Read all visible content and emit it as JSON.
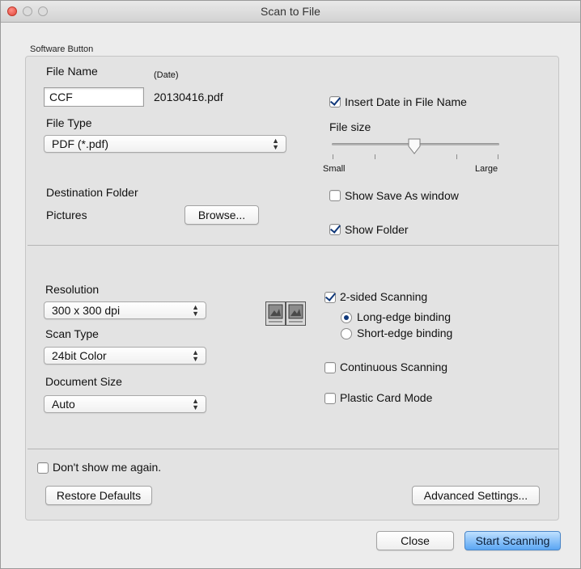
{
  "window": {
    "title": "Scan to File"
  },
  "software_button": {
    "section_label": "Software Button",
    "file_name_label": "File Name",
    "file_name_value": "CCF",
    "date_label": "(Date)",
    "date_value": "20130416.pdf",
    "insert_date": {
      "label": "Insert Date in File Name",
      "checked": true
    },
    "file_type_label": "File Type",
    "file_type_value": "PDF (*.pdf)",
    "file_size": {
      "label": "File size",
      "min_label": "Small",
      "max_label": "Large",
      "level": 0.5
    },
    "destination_label": "Destination Folder",
    "destination_value": "Pictures",
    "browse_label": "Browse...",
    "show_save_as": {
      "label": "Show Save As window",
      "checked": false
    },
    "show_folder": {
      "label": "Show Folder",
      "checked": true
    }
  },
  "scan_settings": {
    "resolution_label": "Resolution",
    "resolution_value": "300 x 300 dpi",
    "scan_type_label": "Scan Type",
    "scan_type_value": "24bit Color",
    "document_size_label": "Document Size",
    "document_size_value": "Auto",
    "two_sided": {
      "label": "2-sided Scanning",
      "checked": true
    },
    "long_edge": {
      "label": "Long-edge binding",
      "selected": true
    },
    "short_edge": {
      "label": "Short-edge binding",
      "selected": false
    },
    "continuous": {
      "label": "Continuous Scanning",
      "checked": false
    },
    "plastic_card": {
      "label": "Plastic Card Mode",
      "checked": false
    },
    "binding_icon": "two-sided-binding-icon"
  },
  "footer": {
    "dont_show": {
      "label": "Don't show me again.",
      "checked": false
    },
    "restore_label": "Restore Defaults",
    "advanced_label": "Advanced Settings...",
    "close_label": "Close",
    "start_label": "Start Scanning"
  },
  "colors": {
    "default_button": "#5ba6f3",
    "check_mark": "#10387a",
    "close_light": "#e0443a"
  }
}
